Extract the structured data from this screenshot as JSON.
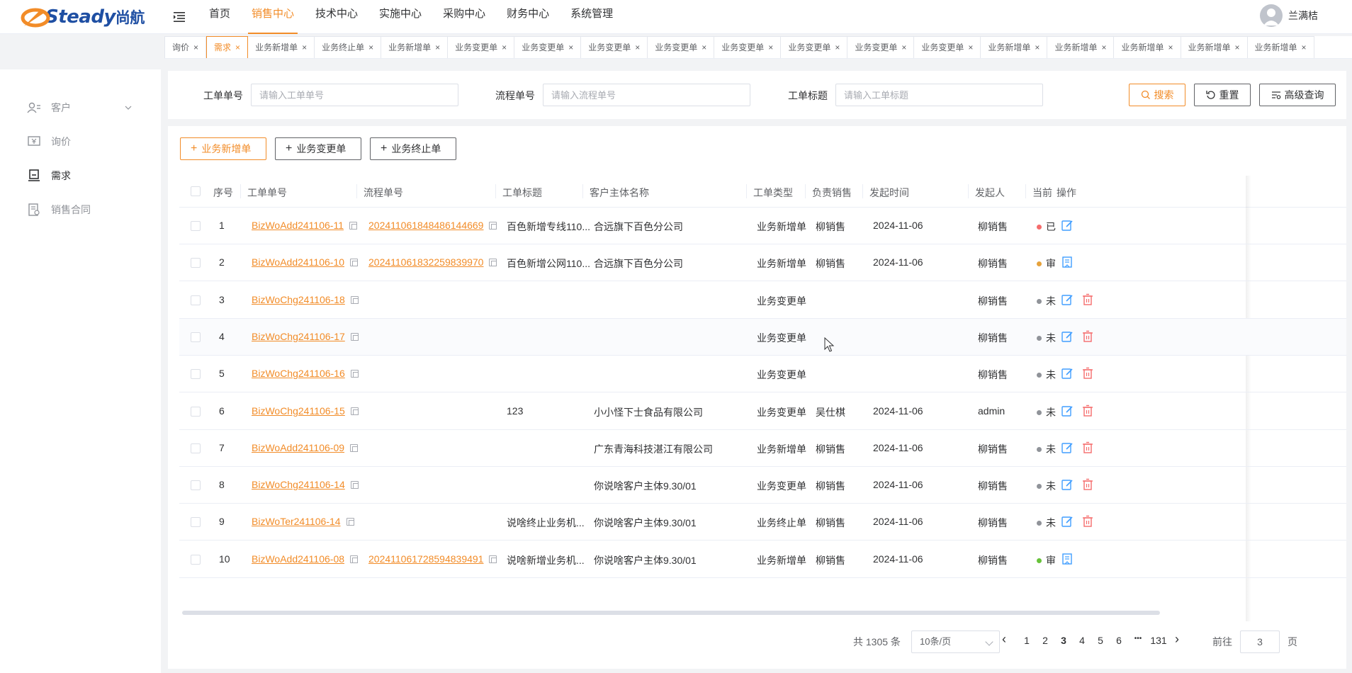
{
  "app": {
    "logo_text": "Steady",
    "logo_cn": "尚航",
    "user_name": "兰满桔"
  },
  "nav": [
    "首页",
    "销售中心",
    "技术中心",
    "实施中心",
    "采购中心",
    "财务中心",
    "系统管理"
  ],
  "nav_active": 1,
  "tabs": [
    "询价",
    "需求",
    "业务新增单",
    "业务终止单",
    "业务新增单",
    "业务变更单",
    "业务变更单",
    "业务变更单",
    "业务变更单",
    "业务变更单",
    "业务变更单",
    "业务变更单",
    "业务变更单",
    "业务新增单",
    "业务新增单",
    "业务新增单",
    "业务新增单",
    "业务新增单"
  ],
  "tabs_active": 1,
  "sidebar": [
    {
      "label": "客户",
      "icon": "customer-icon"
    },
    {
      "label": "询价",
      "icon": "inquiry-icon"
    },
    {
      "label": "需求",
      "icon": "demand-icon"
    },
    {
      "label": "销售合同",
      "icon": "contract-icon"
    }
  ],
  "search": {
    "work_order_label": "工单单号",
    "work_order_placeholder": "请输入工单单号",
    "flow_label": "流程单号",
    "flow_placeholder": "请输入流程单号",
    "title_label": "工单标题",
    "title_placeholder": "请输入工单标题",
    "search_btn": "搜索",
    "reset_btn": "重置",
    "advanced_btn": "高级查询"
  },
  "actions": {
    "add": "业务新增单",
    "change": "业务变更单",
    "terminate": "业务终止单"
  },
  "table": {
    "headers": [
      "序号",
      "工单单号",
      "流程单号",
      "工单标题",
      "客户主体名称",
      "工单类型",
      "负责销售",
      "发起时间",
      "发起人",
      "当前",
      "操作"
    ],
    "rows": [
      {
        "no": "1",
        "wo": "BizWoAdd241106-11",
        "flow": "202411061848486144669",
        "title": "百色新增专线110...",
        "customer": "合远旗下百色分公司",
        "type": "业务新增单",
        "sales": "柳销售",
        "time": "2024-11-06",
        "initiator": "柳销售",
        "status": "已",
        "status_color": "#f56c6c",
        "ops": [
          "edit"
        ]
      },
      {
        "no": "2",
        "wo": "BizWoAdd241106-10",
        "flow": "202411061832259839970",
        "title": "百色新增公网110...",
        "customer": "合远旗下百色分公司",
        "type": "业务新增单",
        "sales": "柳销售",
        "time": "2024-11-06",
        "initiator": "柳销售",
        "status": "审",
        "status_color": "#e6a23c",
        "ops": [
          "review"
        ]
      },
      {
        "no": "3",
        "wo": "BizWoChg241106-18",
        "flow": "",
        "title": "",
        "customer": "",
        "type": "业务变更单",
        "sales": "",
        "time": "",
        "initiator": "柳销售",
        "status": "未",
        "status_color": "#909399",
        "ops": [
          "edit",
          "delete"
        ]
      },
      {
        "no": "4",
        "wo": "BizWoChg241106-17",
        "flow": "",
        "title": "",
        "customer": "",
        "type": "业务变更单",
        "sales": "",
        "time": "",
        "initiator": "柳销售",
        "status": "未",
        "status_color": "#909399",
        "ops": [
          "edit",
          "delete"
        ]
      },
      {
        "no": "5",
        "wo": "BizWoChg241106-16",
        "flow": "",
        "title": "",
        "customer": "",
        "type": "业务变更单",
        "sales": "",
        "time": "",
        "initiator": "柳销售",
        "status": "未",
        "status_color": "#909399",
        "ops": [
          "edit",
          "delete"
        ]
      },
      {
        "no": "6",
        "wo": "BizWoChg241106-15",
        "flow": "",
        "title": "123",
        "customer": "小小怪下士食品有限公司",
        "type": "业务变更单",
        "sales": "吴仕棋",
        "time": "2024-11-06",
        "initiator": "admin",
        "status": "未",
        "status_color": "#909399",
        "ops": [
          "edit",
          "delete"
        ]
      },
      {
        "no": "7",
        "wo": "BizWoAdd241106-09",
        "flow": "",
        "title": "",
        "customer": "广东青海科技湛江有限公司",
        "type": "业务新增单",
        "sales": "柳销售",
        "time": "2024-11-06",
        "initiator": "柳销售",
        "status": "未",
        "status_color": "#909399",
        "ops": [
          "edit",
          "delete"
        ]
      },
      {
        "no": "8",
        "wo": "BizWoChg241106-14",
        "flow": "",
        "title": "",
        "customer": "你说啥客户主体9.30/01",
        "type": "业务变更单",
        "sales": "柳销售",
        "time": "2024-11-06",
        "initiator": "柳销售",
        "status": "未",
        "status_color": "#909399",
        "ops": [
          "edit",
          "delete"
        ]
      },
      {
        "no": "9",
        "wo": "BizWoTer241106-14",
        "flow": "",
        "title": "说啥终止业务机...",
        "customer": "你说啥客户主体9.30/01",
        "type": "业务终止单",
        "sales": "柳销售",
        "time": "2024-11-06",
        "initiator": "柳销售",
        "status": "未",
        "status_color": "#909399",
        "ops": [
          "edit",
          "delete"
        ]
      },
      {
        "no": "10",
        "wo": "BizWoAdd241106-08",
        "flow": "202411061728594839491",
        "title": "说啥新增业务机...",
        "customer": "你说啥客户主体9.30/01",
        "type": "业务新增单",
        "sales": "柳销售",
        "time": "2024-11-06",
        "initiator": "柳销售",
        "status": "审",
        "status_color": "#67c23a",
        "ops": [
          "review"
        ]
      }
    ]
  },
  "pagination": {
    "total_text": "共 1305 条",
    "page_size": "10条/页",
    "pages": [
      "1",
      "2",
      "3",
      "4",
      "5",
      "6",
      "•••",
      "131"
    ],
    "current": "3",
    "goto_label": "前往",
    "goto_value": "3",
    "page_unit": "页"
  },
  "colors": {
    "accent": "#f28c28",
    "primary_blue": "#409eff",
    "danger": "#f56c6c"
  }
}
